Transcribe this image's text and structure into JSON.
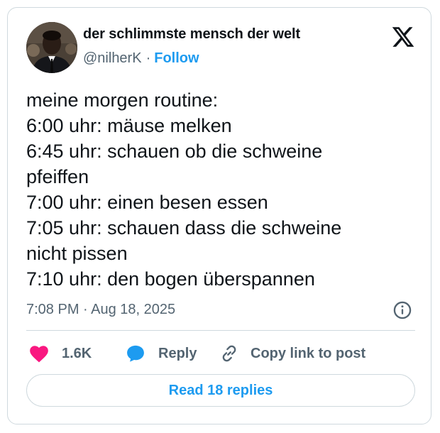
{
  "author": {
    "display_name": "der schlimmste mensch der welt",
    "handle": "@nilherK",
    "separator": "·",
    "follow_label": "Follow"
  },
  "tweet": {
    "lines": [
      "meine morgen routine:",
      "6:00 uhr: mäuse melken",
      "6:45 uhr: schauen ob die schweine",
      "pfeiffen",
      "7:00 uhr: einen besen essen",
      "7:05 uhr: schauen dass die schweine",
      "nicht pissen",
      "7:10 uhr: den bogen überspannen"
    ],
    "timestamp": "7:08 PM · Aug 18, 2025"
  },
  "actions": {
    "like_count": "1.6K",
    "reply_label": "Reply",
    "copy_link_label": "Copy link to post"
  },
  "read_replies_label": "Read 18 replies",
  "icons": {
    "logo": "x-logo-icon",
    "info": "info-icon",
    "like": "heart-icon",
    "reply": "speech-bubble-icon",
    "copy": "link-icon"
  },
  "colors": {
    "accent": "#1d9bf0",
    "heart": "#f91880",
    "secondary_text": "#536471",
    "border": "#cfd9de"
  }
}
